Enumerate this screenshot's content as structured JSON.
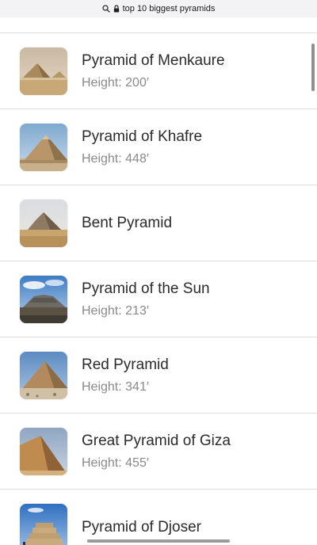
{
  "address_bar": {
    "search_icon": "search-icon",
    "lock_icon": "lock-icon",
    "query": "top 10 biggest pyramids"
  },
  "results": [
    {
      "title": "Pyramid of Menkaure",
      "subtitle": "Height: 200′",
      "thumbnail": "menkaure-pyramid-image"
    },
    {
      "title": "Pyramid of Khafre",
      "subtitle": "Height: 448′",
      "thumbnail": "khafre-pyramid-image"
    },
    {
      "title": "Bent Pyramid",
      "subtitle": "",
      "thumbnail": "bent-pyramid-image"
    },
    {
      "title": "Pyramid of the Sun",
      "subtitle": "Height: 213′",
      "thumbnail": "sun-pyramid-image"
    },
    {
      "title": "Red Pyramid",
      "subtitle": "Height: 341′",
      "thumbnail": "red-pyramid-image"
    },
    {
      "title": "Great Pyramid of Giza",
      "subtitle": "Height: 455′",
      "thumbnail": "giza-pyramid-image"
    },
    {
      "title": "Pyramid of Djoser",
      "subtitle": "",
      "thumbnail": "djoser-pyramid-image"
    }
  ]
}
